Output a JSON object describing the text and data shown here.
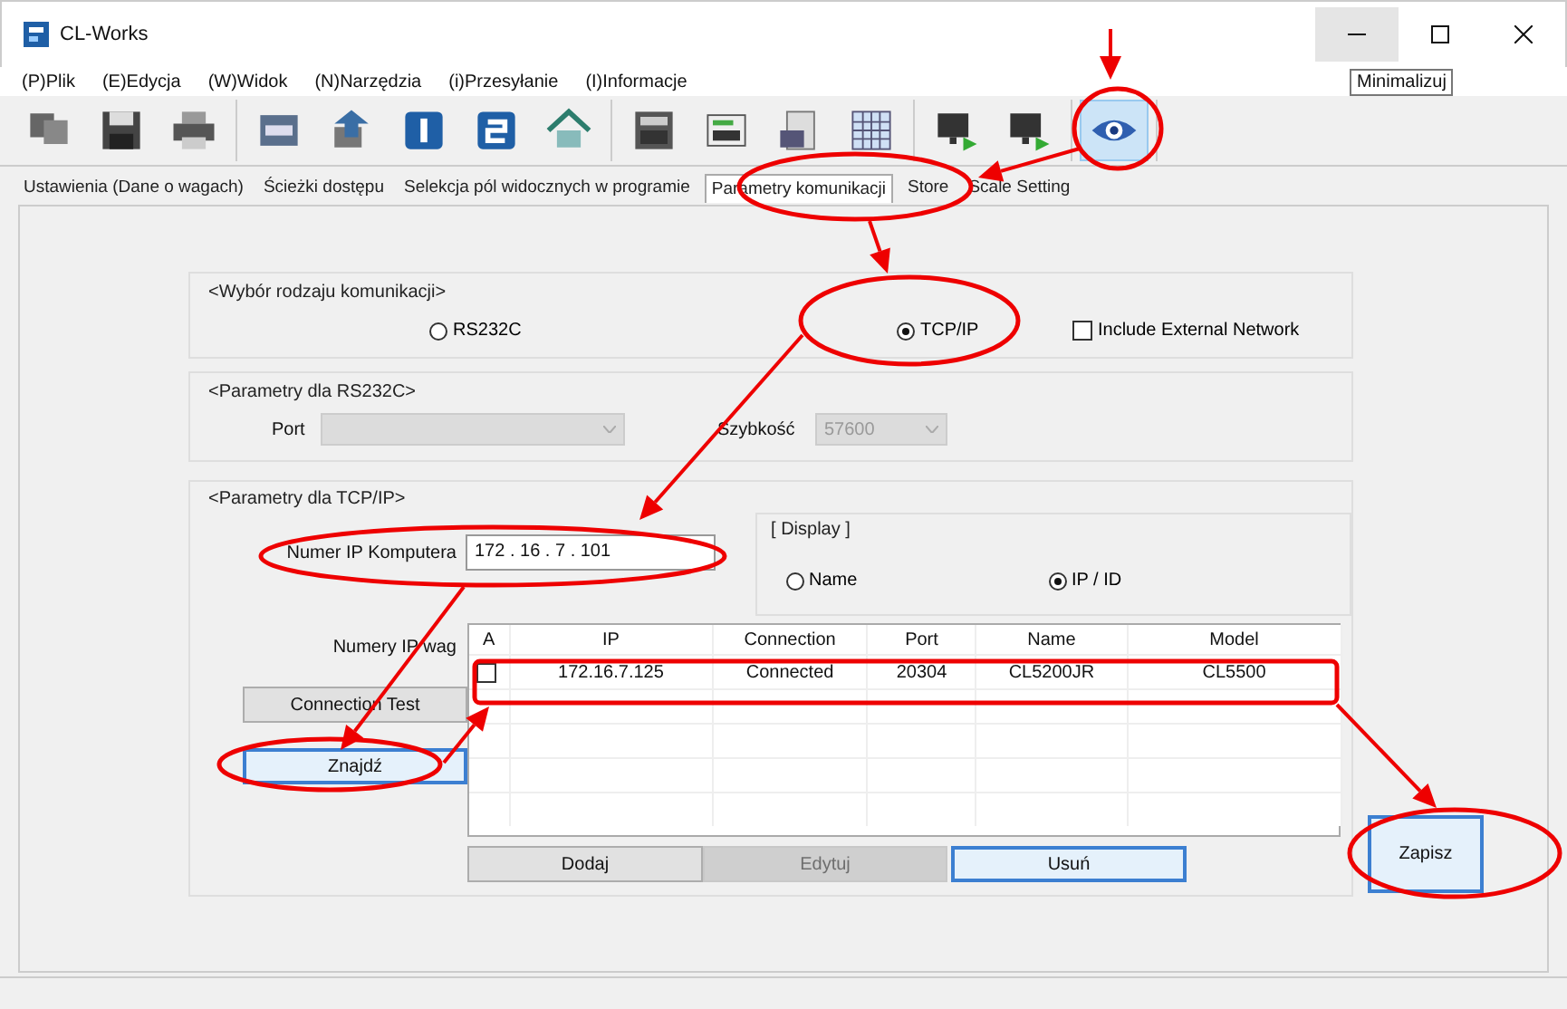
{
  "window": {
    "title": "CL-Works",
    "tooltip": "Minimalizuj"
  },
  "menu": [
    "(P)Plik",
    "(E)Edycja",
    "(W)Widok",
    "(N)Narzędzia",
    "(i)Przesyłanie",
    "(I)Informacje"
  ],
  "toolbar_groups": [
    [
      {
        "selected": false
      },
      {
        "selected": false
      },
      {
        "selected": false
      }
    ],
    [
      {
        "selected": false
      },
      {
        "selected": false
      },
      {
        "selected": false
      },
      {
        "selected": false
      },
      {
        "selected": false
      }
    ],
    [
      {
        "selected": false
      },
      {
        "selected": false
      },
      {
        "selected": false
      },
      {
        "selected": false
      }
    ],
    [
      {
        "selected": false
      },
      {
        "selected": false
      }
    ],
    [
      {
        "selected": true
      }
    ]
  ],
  "tabs": [
    {
      "label": "Ustawienia (Dane o wagach)",
      "selected": false
    },
    {
      "label": "Ścieżki dostępu",
      "selected": false
    },
    {
      "label": "Selekcja pól widocznych w programie",
      "selected": false
    },
    {
      "label": "Parametry komunikacji",
      "selected": true
    },
    {
      "label": "Store",
      "selected": false
    },
    {
      "label": "Scale Setting",
      "selected": false
    }
  ],
  "communication_type": {
    "legend": "<Wybór rodzaju komunikacji>",
    "options": [
      {
        "label": "RS232C",
        "selected": false
      },
      {
        "label": "TCP/IP",
        "selected": true
      }
    ],
    "external": {
      "label": "Include External Network",
      "checked": false
    }
  },
  "rs232c": {
    "legend": "<Parametry dla RS232C>",
    "port": {
      "label": "Port",
      "disabled": true
    },
    "speed": {
      "label": "Szybkość",
      "value": "57600",
      "disabled": true
    }
  },
  "tcpip": {
    "legend": "<Parametry dla TCP/IP>",
    "pc_ip": {
      "label": "Numer IP Komputera",
      "value": "172 . 16 . 7 . 101"
    },
    "display": {
      "legend": "[ Display ]",
      "options": [
        {
          "label": "Name",
          "selected": false
        },
        {
          "label": "IP / ID",
          "selected": true
        }
      ]
    },
    "scale_ips_label": "Numery IP wag",
    "buttons": [
      {
        "label": "Connection Test",
        "focused": false
      },
      {
        "label": "Znajdź",
        "focused": true
      }
    ],
    "table": {
      "check_column": "A",
      "columns": [
        "IP",
        "Connection",
        "Port",
        "Name",
        "Model"
      ],
      "rows": [
        {
          "checked": false,
          "cells": [
            "172.16.7.125",
            "Connected",
            "20304",
            "CL5200JR",
            "CL5500"
          ]
        }
      ]
    },
    "table_buttons": [
      {
        "label": "Dodaj",
        "disabled": false,
        "focused": false
      },
      {
        "label": "Edytuj",
        "disabled": true,
        "focused": false
      },
      {
        "label": "Usuń",
        "disabled": false,
        "focused": true
      }
    ]
  },
  "save_button": {
    "label": "Zapisz",
    "focused": true
  }
}
